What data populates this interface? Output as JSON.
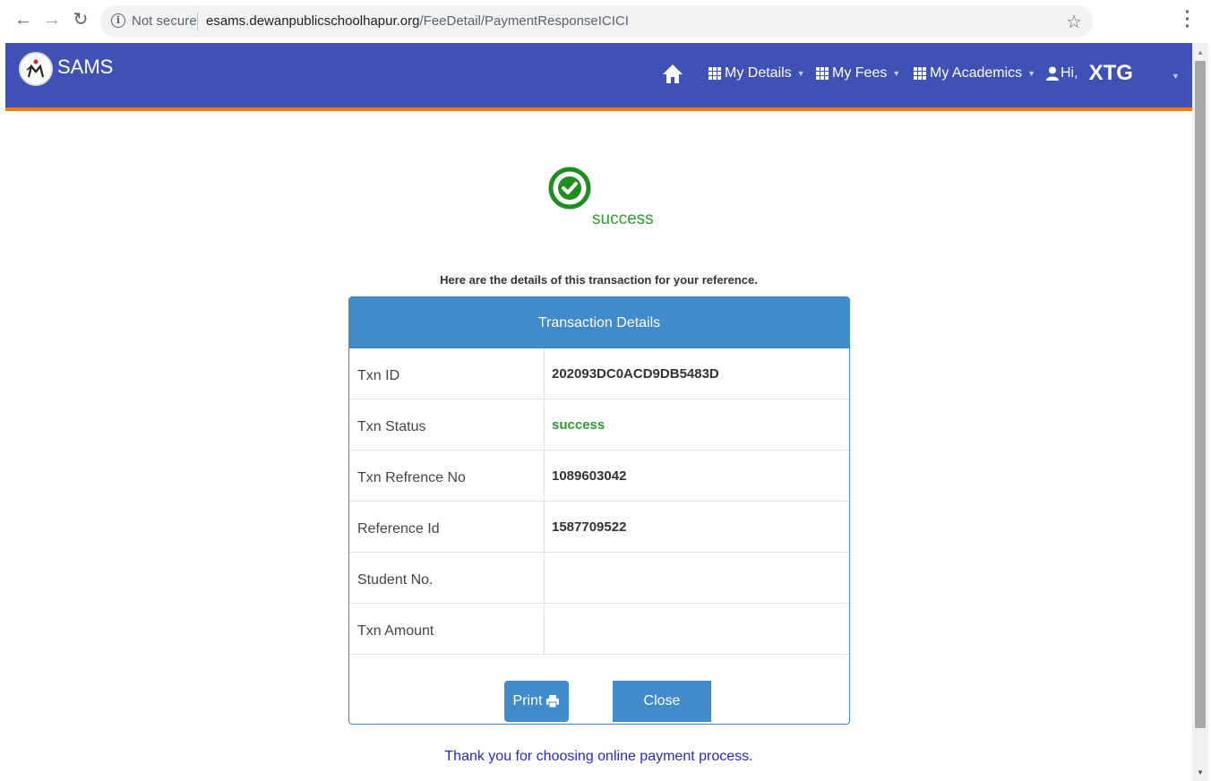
{
  "browser": {
    "security_label": "Not secure",
    "url_host": "esams.dewanpublicschoolhapur.org",
    "url_path": "/FeeDetail/PaymentResponseICICI"
  },
  "navbar": {
    "brand": "SAMS",
    "items": [
      {
        "label": "My Details"
      },
      {
        "label": "My Fees"
      },
      {
        "label": "My Academics"
      }
    ],
    "greeting": "Hi,",
    "username": "XTG"
  },
  "status": {
    "text": "success",
    "color": "#2e9e2e"
  },
  "reference_note": "Here are the details of this transaction for your reference.",
  "panel": {
    "title": "Transaction Details",
    "rows": [
      {
        "label": "Txn ID",
        "value": "202093DC0ACD9DB5483D"
      },
      {
        "label": "Txn Status",
        "value": "success"
      },
      {
        "label": "Txn Refrence No",
        "value": "1089603042"
      },
      {
        "label": "Reference Id",
        "value": "1587709522"
      },
      {
        "label": "Student No.",
        "value": ""
      },
      {
        "label": "Txn Amount",
        "value": ""
      }
    ],
    "print_label": "Print",
    "close_label": "Close"
  },
  "thanks": "Thank you for choosing online payment process.",
  "colors": {
    "navbar": "#3f51b5",
    "accent_bar": "#f57c00",
    "primary_button": "#428bca"
  }
}
